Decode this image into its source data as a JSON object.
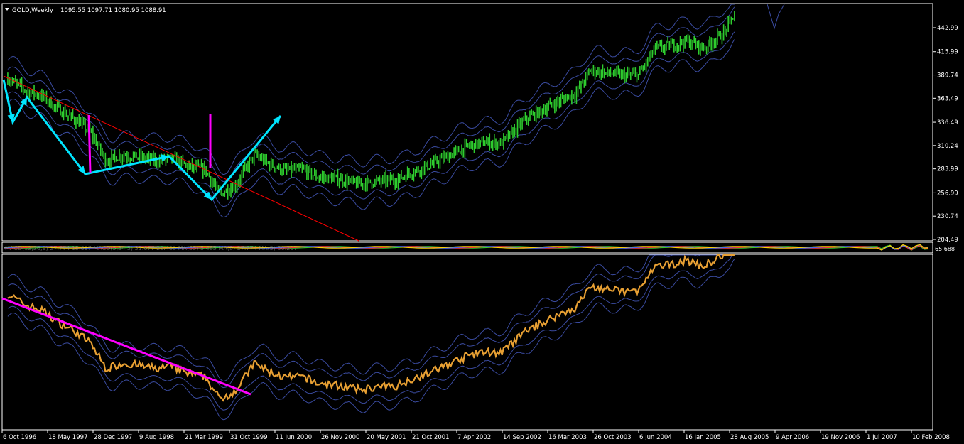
{
  "chart_data": [
    {
      "type": "bar",
      "description": "GOLD weekly OHLC bars with envelope/Bollinger bands, red trendline, cyan wave arrows and magenta spike markers",
      "symbol": "GOLD,Weekly",
      "ohlc_text": "1095.55 1097.71 1080.95 1088.91",
      "yticks": [
        442.99,
        415.99,
        389.74,
        363.49,
        336.49,
        310.24,
        283.99,
        256.99,
        230.74,
        204.49
      ],
      "ylim": [
        204.49,
        460
      ],
      "xticks": [
        "6 Oct 1996",
        "18 May 1997",
        "28 Dec 1997",
        "9 Aug 1998",
        "21 Mar 1999",
        "31 Oct 1999",
        "11 Jun 2000",
        "26 Nov 2000",
        "20 May 2001",
        "21 Oct 2001",
        "7 Apr 2002",
        "14 Sep 2002",
        "16 Mar 2003",
        "26 Oct 2003",
        "6 Jun 2004",
        "16 Jan 2005",
        "28 Aug 2005",
        "9 Apr 2006",
        "19 Nov 2006",
        "1 Jul 2007",
        "10 Feb 2008"
      ],
      "series": [
        {
          "x": [
            1996.77,
            1997.0,
            1997.2,
            1997.38,
            1997.6,
            1997.8,
            1997.99,
            1998.2,
            1998.4,
            1998.61,
            1998.8,
            1999.0,
            1999.22,
            1999.4,
            1999.6,
            1999.83,
            2000.0,
            2000.2,
            2000.44,
            2000.6,
            2000.9,
            2001.1,
            2001.38,
            2001.6,
            2001.8,
            2002.0,
            2002.27,
            2002.5,
            2002.7,
            2002.9,
            2003.2,
            2003.4,
            2003.6,
            2003.82,
            2004.0,
            2004.2,
            2004.43,
            2004.6,
            2004.8,
            2005.04,
            2005.2,
            2005.4,
            2005.66,
            2005.8
          ],
          "values": [
            386,
            372,
            366,
            352,
            340,
            325,
            293,
            300,
            297,
            293,
            296,
            287,
            283,
            255,
            266,
            300,
            290,
            282,
            283,
            275,
            272,
            267,
            270,
            272,
            281,
            288,
            300,
            310,
            314,
            313,
            340,
            350,
            360,
            369,
            395,
            392,
            389,
            390,
            419,
            424,
            428,
            420,
            437,
            460
          ]
        }
      ],
      "annotations": {
        "trendline_color": "#ff0000",
        "wave_arrow_color": "#00e5ff",
        "spike_marker_color": "#ff00ff"
      },
      "grid": false
    },
    {
      "type": "line",
      "description": "Oscillator strip (collapsed MACD/MA panel)",
      "legend_text": "MACD(12,26,9) 27.774 15.697 MACD(5,34,5) 31.677 22.400 MA(55) 5.485 MA(8) 27.774 MA(5) 30.207",
      "right_labels": "65.688"
    },
    {
      "type": "line",
      "description": "Lower panel: gold close line with bands and magenta trendline",
      "series": [
        {
          "x": [
            1996.77,
            1997.0,
            1997.2,
            1997.38,
            1997.6,
            1997.8,
            1997.99,
            1998.2,
            1998.4,
            1998.61,
            1998.8,
            1999.0,
            1999.22,
            1999.4,
            1999.6,
            1999.83,
            2000.0,
            2000.2,
            2000.44,
            2000.6,
            2000.9,
            2001.1,
            2001.38,
            2001.6,
            2001.8,
            2002.0,
            2002.27,
            2002.5,
            2002.7,
            2002.9,
            2003.2,
            2003.4,
            2003.6,
            2003.82,
            2004.0,
            2004.2,
            2004.43,
            2004.6,
            2004.8,
            2005.04,
            2005.2,
            2005.4,
            2005.66,
            2005.8
          ],
          "values": [
            386,
            372,
            366,
            352,
            340,
            325,
            293,
            300,
            297,
            293,
            296,
            287,
            283,
            255,
            266,
            300,
            290,
            282,
            283,
            275,
            272,
            267,
            270,
            272,
            281,
            288,
            300,
            310,
            314,
            313,
            340,
            350,
            360,
            369,
            395,
            392,
            389,
            390,
            419,
            424,
            428,
            420,
            437,
            460
          ]
        }
      ],
      "annotations": {
        "line_color": "#e8a033",
        "trendline_color": "#ff00ff",
        "band_color": "#3a4ba0"
      }
    }
  ],
  "colors": {
    "background": "#000000",
    "frame": "#ffffff",
    "bars": "#2ecc2e",
    "bands": "#3a4ba0",
    "axis_text": "#ffffff"
  }
}
